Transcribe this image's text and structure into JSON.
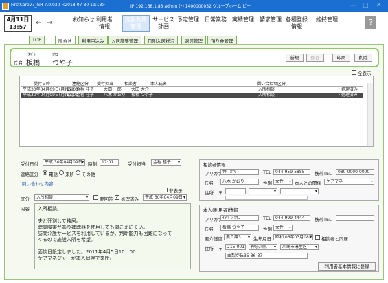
{
  "window": {
    "title": "FirstCareV7_GH 7.0.030 <2018-07-30 19:13>",
    "info": "IP:192.168.1.83 admin (*) 1400000032 グループホーム ビー"
  },
  "menubar": {
    "date_line1": "4月11日",
    "date_line2": "13:57",
    "back": "←",
    "forward": "→",
    "items": [
      "お知らせ",
      "利用者\n情報",
      "施設利用\n管理",
      "サービス\n計画",
      "予定管理",
      "日常業務",
      "実績管理",
      "請求管理",
      "各種登録\n情報",
      "維持管理"
    ],
    "selected": "施設利用\n管理",
    "help": "?"
  },
  "tabs": [
    "TOP",
    "問合せ",
    "利用申込み",
    "入居調整管理",
    "日別入居状況",
    "退居管理",
    "預り金管理"
  ],
  "active_tab": "問合せ",
  "header": {
    "name_label": "氏名",
    "kana_sei": "ｲﾀﾊﾞｼ",
    "kana_mei": "ﾂﾔｺ",
    "sei": "板橋",
    "mei": "つや子",
    "buttons": {
      "new": "新規",
      "save": "保存",
      "print": "印刷",
      "delete": "削除"
    }
  },
  "list": {
    "show_all_label": "全表示",
    "columns": [
      "受付日時",
      "連絡区分",
      "受付担当",
      "相談者",
      "本人氏名",
      "問い合わせ区分"
    ],
    "rows": [
      {
        "date": "平成30年04月09日(月)17:03",
        "contact": "電話",
        "staff": "金程 桂子",
        "consultant": "大田 一郎",
        "person": "大田 大介",
        "category": "入所相談",
        "status": "・処理済み"
      },
      {
        "date": "平成30年04月09日(月)17:01",
        "contact": "電話",
        "staff": "金程 桂子",
        "consultant": "八木 かおり",
        "person": "板橋 つや子",
        "category": "入所相談",
        "status": "・処理済み"
      }
    ]
  },
  "form": {
    "reception_label": "受付日付",
    "reception_date": "平成 30年04月09日",
    "time_label": "時刻",
    "time": "17:01",
    "staff_label": "受付担当",
    "staff": "金程 桂子",
    "contact_label": "連絡区分",
    "contact_options": [
      "電話",
      "来所",
      "その他"
    ],
    "contact_selected": "電話",
    "inquiry_link": "問い合わせ内容",
    "hidden_label": "非表示",
    "category_label": "区分",
    "category": "入所相談",
    "reply_label": "要回答",
    "processed_label": "処理済み",
    "processed_date": "平成 30年04月09日",
    "content_label": "内容",
    "content_lines": [
      "入所相談。",
      "",
      "夫と死別して独居。",
      "聴覚障害があり補聴器を使用しても聞こえにくい。",
      "訪問介護サービスを利用しているが、判断能力も困難になって",
      "くるので施設入所を希望。",
      "",
      "面談日設定しました。2011年4月5日10：00",
      "ケアマネジャーが本人同伴で来所。"
    ]
  },
  "consultant": {
    "title": "相談者情報",
    "furigana_label": "フリガナ",
    "furigana": "ﾔｷﾞ ｶｵﾘ",
    "tel_label": "TEL",
    "tel": "044-959-5885",
    "mobile_label": "携帯TEL",
    "mobile": "080-0000-0000",
    "name_label": "氏名",
    "name": "八木 かおり",
    "sex_label": "性別",
    "sex": "女性",
    "relation_label": "本人との関係",
    "relation": "ケアマネ",
    "address_label": "住所",
    "postal_mark": "〒"
  },
  "person": {
    "title": "本人(利用者)情報",
    "furigana_label": "フリガナ",
    "furigana": "ｲﾀﾊﾞｼ ﾂﾔｺ",
    "tel_label": "TEL",
    "tel": "044-999-4444",
    "mobile_label": "携帯TEL",
    "mobile": "",
    "name_label": "氏名",
    "name": "板橋 つや子",
    "sex_label": "性別",
    "sex": "女性",
    "care_label": "要介護度",
    "care": "要介護3",
    "birth_label": "生年月日",
    "birth": "昭和 06年03月08日",
    "sync_label": "相談者と同居",
    "address_label": "住所",
    "postal": "215-0011",
    "pref": "神奈川県",
    "city": "川崎市麻生区",
    "street": "由梨が丘35-36-37",
    "register_button": "利用者基本情報に登録"
  }
}
